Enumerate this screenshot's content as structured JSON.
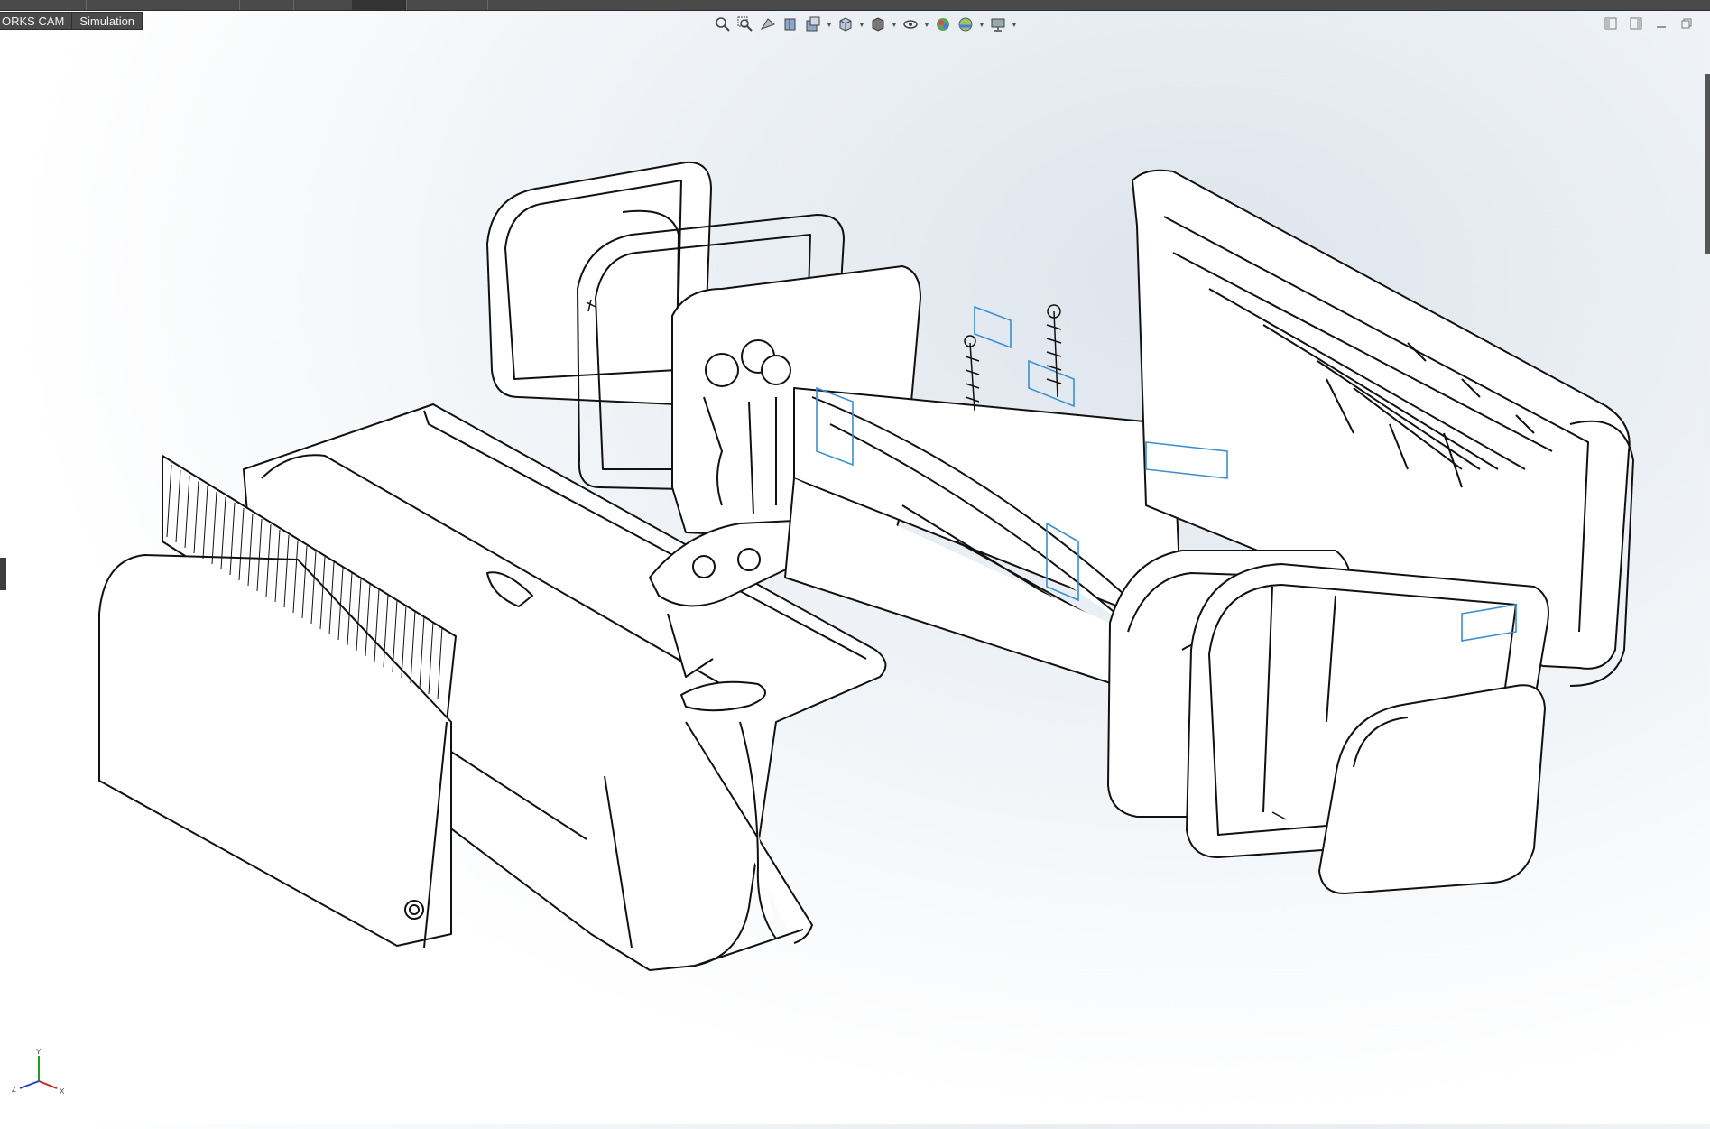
{
  "window": {
    "tabs": [
      {
        "label": "ORKS CAM"
      },
      {
        "label": "Simulation"
      }
    ]
  },
  "heads_up_toolbar": {
    "buttons": [
      {
        "icon": "zoom-to-fit-icon"
      },
      {
        "icon": "zoom-to-area-icon"
      },
      {
        "icon": "previous-view-icon"
      },
      {
        "icon": "section-view-icon"
      },
      {
        "icon": "dynamic-annotation-views-icon"
      },
      {
        "icon": "view-orientation-icon"
      },
      {
        "icon": "display-style-icon"
      },
      {
        "icon": "hide-show-items-icon"
      },
      {
        "icon": "edit-appearance-icon"
      },
      {
        "icon": "apply-scene-icon"
      },
      {
        "icon": "view-settings-icon"
      }
    ]
  },
  "window_controls": [
    {
      "icon": "tile-left-icon"
    },
    {
      "icon": "tile-right-icon"
    },
    {
      "icon": "minimize-icon"
    },
    {
      "icon": "restore-icon"
    }
  ],
  "triad": {
    "axes": [
      "Y",
      "Z",
      "X"
    ],
    "colors": {
      "x": "#d22020",
      "y": "#20a020",
      "z": "#2040d0"
    }
  },
  "model": {
    "description_colors": {
      "edge": "#111111",
      "highlight": "#3a8fd0"
    }
  }
}
